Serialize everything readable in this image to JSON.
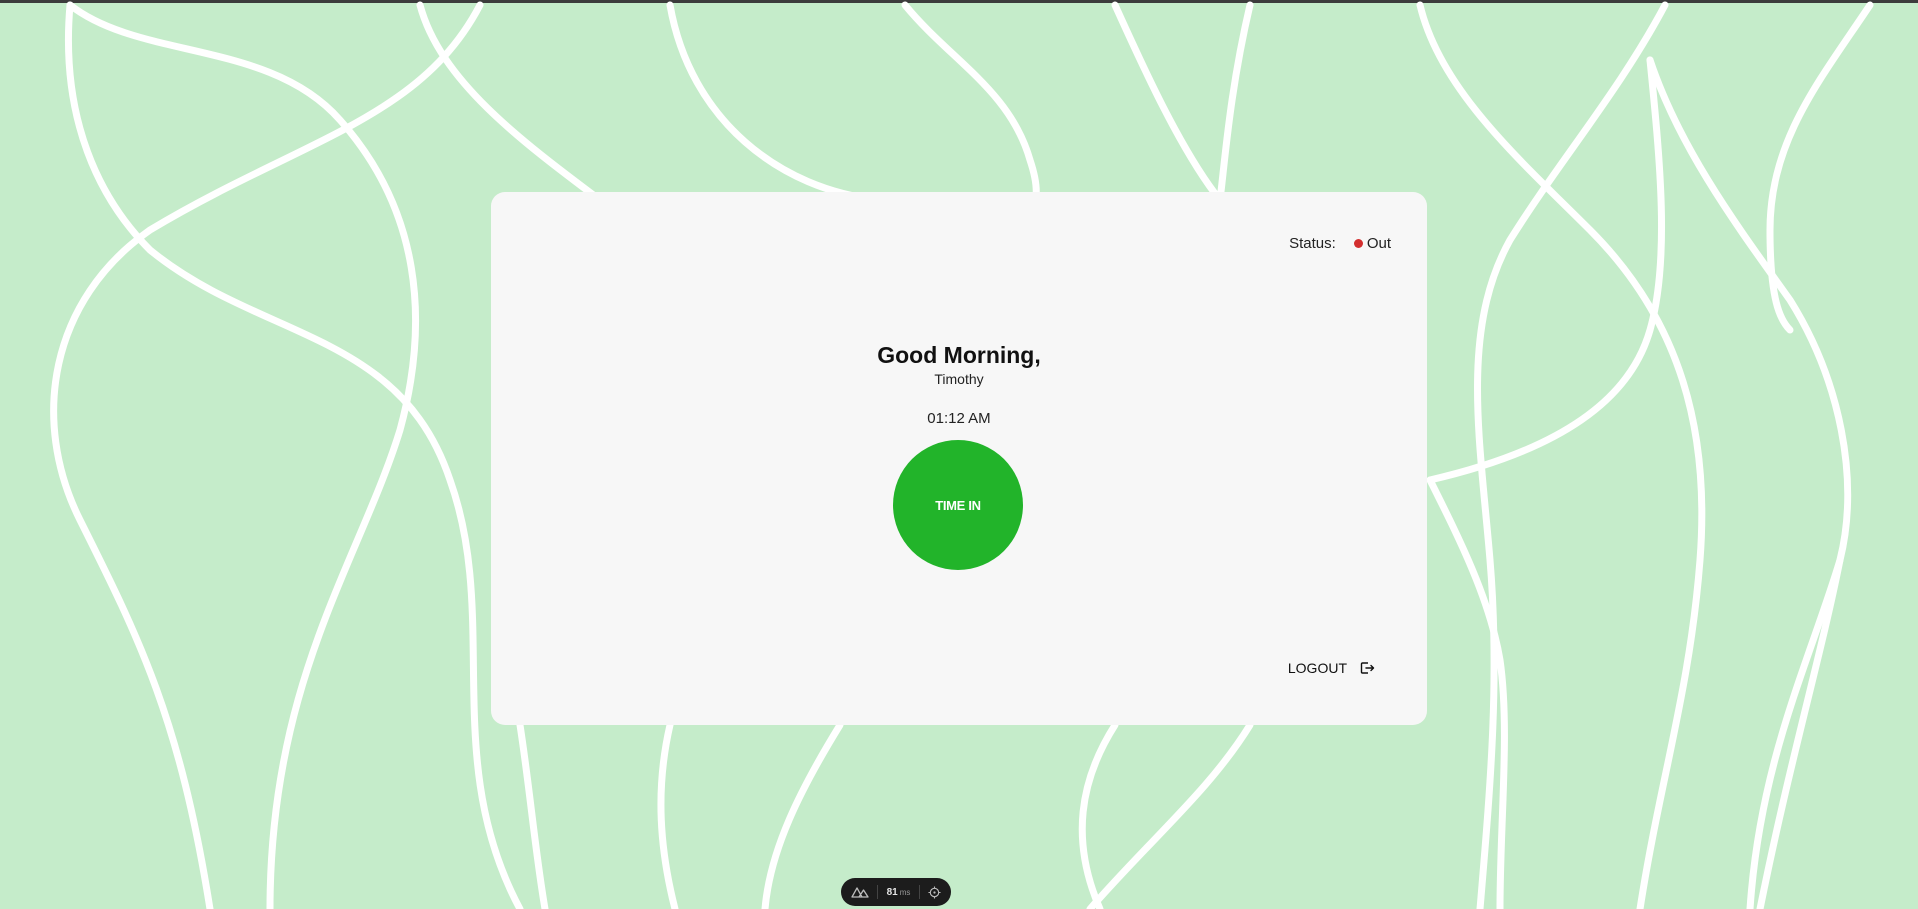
{
  "status": {
    "label": "Status:",
    "value": "Out",
    "indicator_color": "#d32f2f"
  },
  "greeting": {
    "title": "Good Morning,",
    "name": "Timothy"
  },
  "clock": {
    "time": "01:12 AM"
  },
  "action": {
    "time_in_label": "TIME IN",
    "button_color": "#22b42a"
  },
  "logout": {
    "label": "LOGOUT",
    "icon": "logout-icon"
  },
  "devtools": {
    "logo_icon": "nuxt-logo-icon",
    "render_time": "81",
    "render_unit": "ms",
    "inspect_icon": "crosshair-icon"
  },
  "theme": {
    "background": "#c5ecca",
    "card": "#f7f7f7"
  }
}
